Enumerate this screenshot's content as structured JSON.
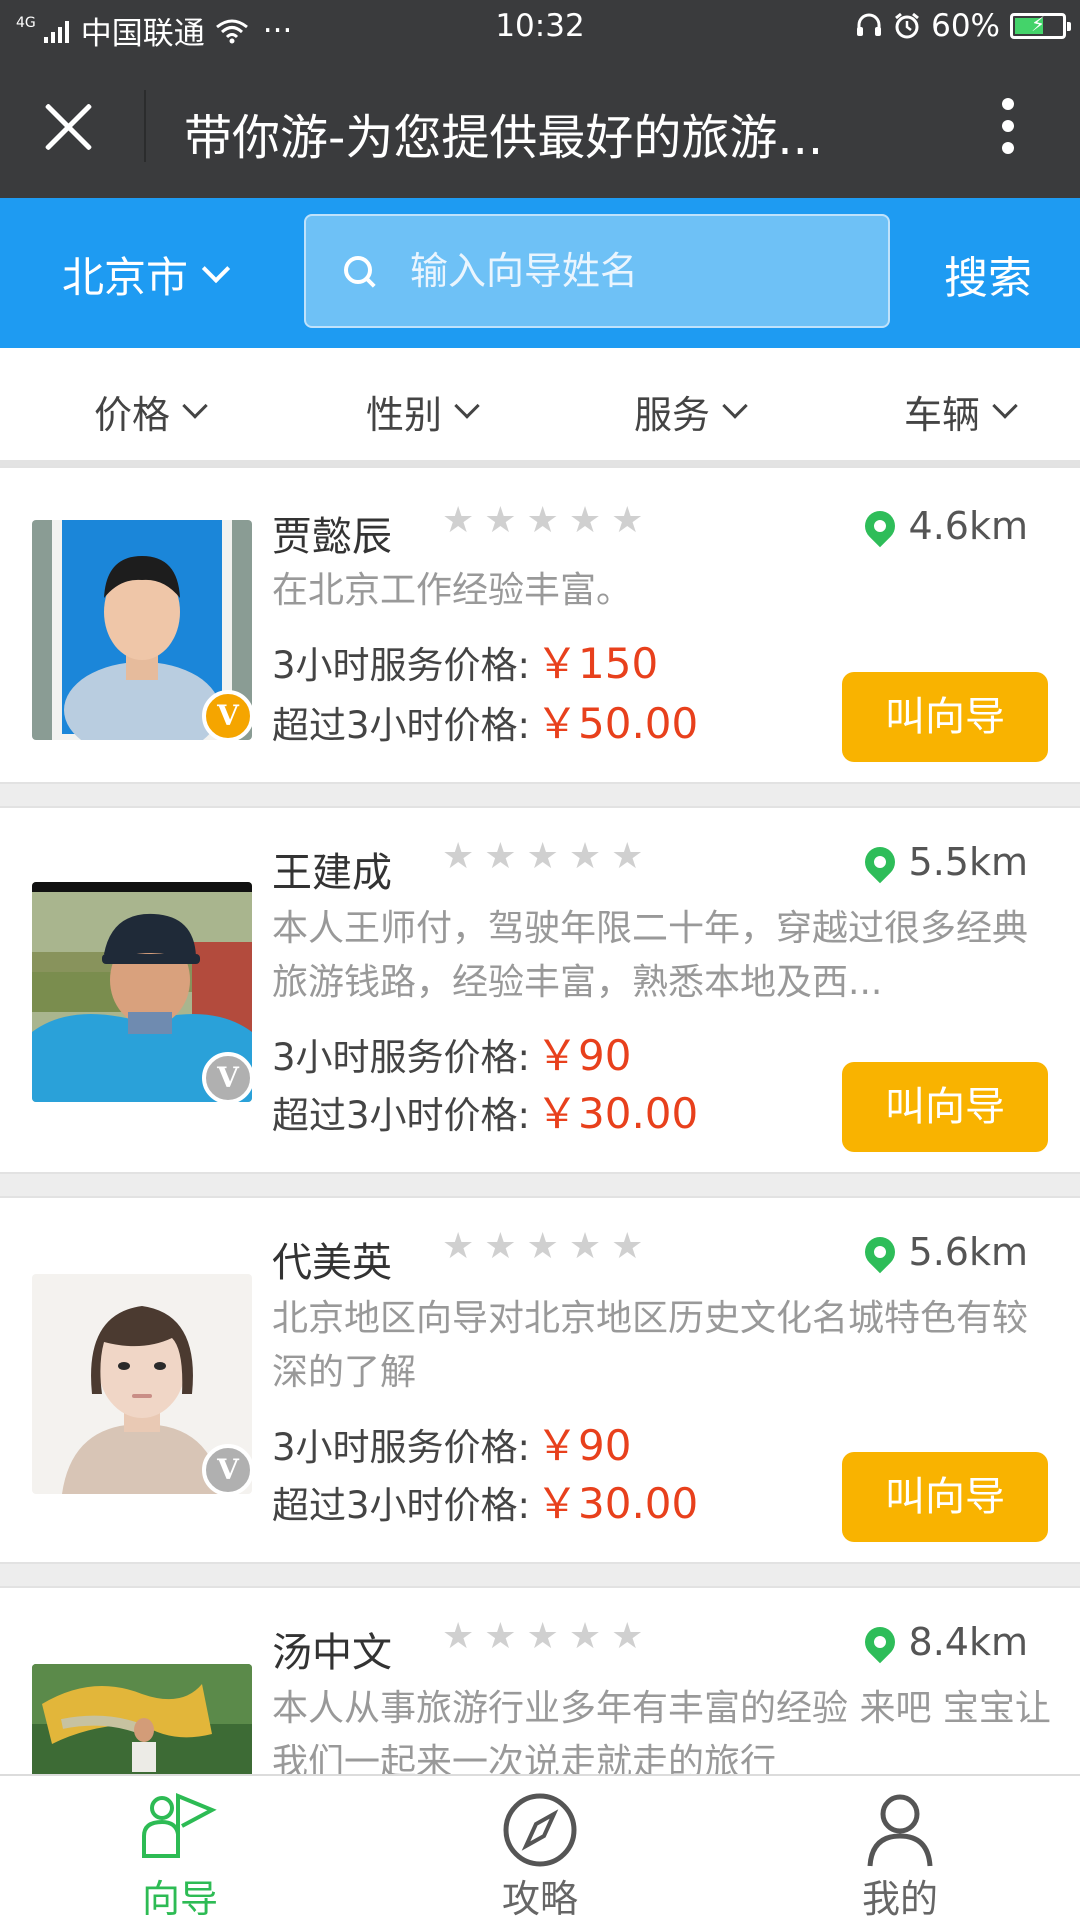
{
  "status_bar": {
    "network": "4G",
    "carrier": "中国联通",
    "dots": "···",
    "time": "10:32",
    "battery": "60%",
    "battery_level": 0.6
  },
  "title_bar": {
    "title": "带你游-为您提供最好的旅游..."
  },
  "search": {
    "city": "北京市",
    "placeholder": "输入向导姓名",
    "value": "",
    "button": "搜索"
  },
  "filters": [
    {
      "label": "价格"
    },
    {
      "label": "性别"
    },
    {
      "label": "服务"
    },
    {
      "label": "车辆"
    }
  ],
  "guides": [
    {
      "name": "贾懿辰",
      "rating": 0,
      "distance": "4.6km",
      "description": "在北京工作经验丰富。",
      "price_3h_label": "3小时服务价格:",
      "price_3h": "￥150",
      "price_over_label": "超过3小时价格:",
      "price_over": "￥50.00",
      "verified": true,
      "button": "叫向导"
    },
    {
      "name": "王建成",
      "rating": 0,
      "distance": "5.5km",
      "description": "本人王师付，驾驶年限二十年，穿越过很多经典旅游钱路，经验丰富，熟悉本地及西...",
      "price_3h_label": "3小时服务价格:",
      "price_3h": "￥90",
      "price_over_label": "超过3小时价格:",
      "price_over": "￥30.00",
      "verified": false,
      "button": "叫向导"
    },
    {
      "name": "代美英",
      "rating": 0,
      "distance": "5.6km",
      "description": "北京地区向导对北京地区历史文化名城特色有较深的了解",
      "price_3h_label": "3小时服务价格:",
      "price_3h": "￥90",
      "price_over_label": "超过3小时价格:",
      "price_over": "￥30.00",
      "verified": false,
      "button": "叫向导"
    },
    {
      "name": "汤中文",
      "rating": 0,
      "distance": "8.4km",
      "description": "本人从事旅游行业多年有丰富的经验 来吧 宝宝让我们一起来一次说走就走的旅行"
    }
  ],
  "tabs": [
    {
      "label": "向导",
      "icon": "guide-icon",
      "active": true
    },
    {
      "label": "攻略",
      "icon": "compass-icon",
      "active": false
    },
    {
      "label": "我的",
      "icon": "user-icon",
      "active": false
    }
  ],
  "colors": {
    "header_bg": "#3a3b3d",
    "brand_blue": "#1e9bf2",
    "button_yellow": "#f9b300",
    "price_red": "#e8401c",
    "active_green": "#2dbb54",
    "badge_gold": "#f5a500"
  }
}
